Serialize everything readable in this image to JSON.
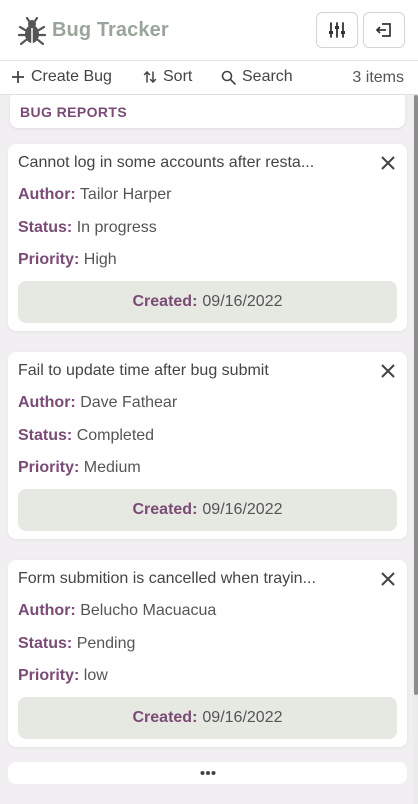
{
  "app": {
    "title": "Bug Tracker"
  },
  "header": {
    "icons": [
      "bug-icon",
      "sliders-icon",
      "logout-icon"
    ]
  },
  "toolbar": {
    "create_label": "Create Bug",
    "sort_label": "Sort",
    "search_label": "Search",
    "count": "3 items"
  },
  "section": {
    "title": "BUG REPORTS"
  },
  "labels": {
    "author": "Author:",
    "status": "Status:",
    "priority": "Priority:",
    "created": "Created:"
  },
  "bugs": [
    {
      "title": "Cannot log in some accounts after resta...",
      "author": "Tailor Harper",
      "status": "In progress",
      "priority": "High",
      "created": "09/16/2022"
    },
    {
      "title": "Fail to update time after bug submit",
      "author": "Dave Fathear",
      "status": "Completed",
      "priority": "Medium",
      "created": "09/16/2022"
    },
    {
      "title": "Form submition is cancelled when trayin...",
      "author": "Belucho Macuacua",
      "status": "Pending",
      "priority": "low",
      "created": "09/16/2022"
    }
  ],
  "colors": {
    "accent": "#7a4b76",
    "logo": "#9aa59a",
    "created_bg": "#e6e8e2"
  }
}
